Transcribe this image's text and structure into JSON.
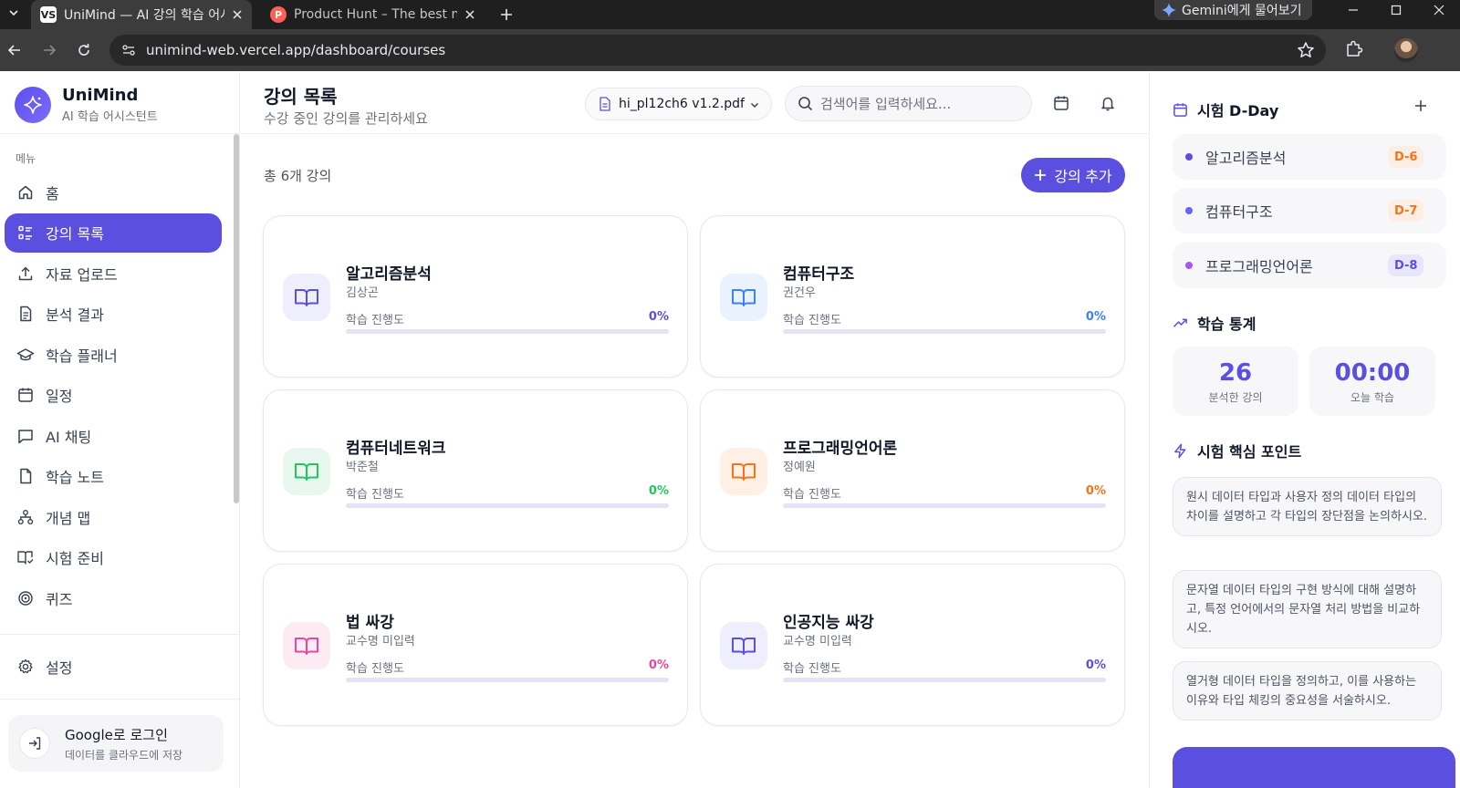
{
  "browser": {
    "tabs": [
      {
        "title": "UniMind — AI 강의 학습 어시스턴트",
        "favicon": "VS"
      },
      {
        "title": "Product Hunt – The best new products",
        "favicon": "P"
      }
    ],
    "gemini_label": "Gemini에게 물어보기",
    "url": "unimind-web.vercel.app/dashboard/courses"
  },
  "sidebar": {
    "brand_name": "UniMind",
    "brand_sub": "AI 학습 어시스턴트",
    "menu_label": "메뉴",
    "items": [
      {
        "label": "홈",
        "icon": "home-icon"
      },
      {
        "label": "강의 목록",
        "icon": "list-icon"
      },
      {
        "label": "자료 업로드",
        "icon": "upload-icon"
      },
      {
        "label": "분석 결과",
        "icon": "document-icon"
      },
      {
        "label": "학습 플래너",
        "icon": "graduation-cap-icon"
      },
      {
        "label": "일정",
        "icon": "calendar-icon"
      },
      {
        "label": "AI 채팅",
        "icon": "chat-icon"
      },
      {
        "label": "학습 노트",
        "icon": "note-icon"
      },
      {
        "label": "개념 맵",
        "icon": "network-icon"
      },
      {
        "label": "시험 준비",
        "icon": "book-check-icon"
      },
      {
        "label": "퀴즈",
        "icon": "target-icon"
      }
    ],
    "settings_label": "설정",
    "login_title": "Google로 로그인",
    "login_sub": "데이터를 클라우드에 저장"
  },
  "header": {
    "title": "강의 목록",
    "subtitle": "수강 중인 강의를 관리하세요",
    "file_name": "hi_pl12ch6 v1.2.pdf",
    "search_placeholder": "검색어를 입력하세요..."
  },
  "courses_summary": {
    "count_label": "총 6개 강의",
    "add_label": "강의 추가"
  },
  "courses": [
    {
      "title": "알고리즘분석",
      "professor": "김상곤",
      "progress_label": "학습 진행도",
      "progress": "0%",
      "progress_fraction": 0,
      "color": "#5b4fe0",
      "tint": "#efeefc"
    },
    {
      "title": "컴퓨터구조",
      "professor": "권건우",
      "progress_label": "학습 진행도",
      "progress": "0%",
      "progress_fraction": 0,
      "color": "#3b82f6",
      "tint": "#eaf2fe"
    },
    {
      "title": "컴퓨터네트워크",
      "professor": "박준철",
      "progress_label": "학습 진행도",
      "progress": "0%",
      "progress_fraction": 0,
      "color": "#22c55e",
      "tint": "#e8f8ee"
    },
    {
      "title": "프로그래밍언어론",
      "professor": "정예원",
      "progress_label": "학습 진행도",
      "progress": "0%",
      "progress_fraction": 0,
      "color": "#f97316",
      "tint": "#fff0e6"
    },
    {
      "title": "법 싸강",
      "professor": "교수명 미입력",
      "progress_label": "학습 진행도",
      "progress": "0%",
      "progress_fraction": 0,
      "color": "#ec4899",
      "tint": "#fdebf4"
    },
    {
      "title": "인공지능 싸강",
      "professor": "교수명 미입력",
      "progress_label": "학습 진행도",
      "progress": "0%",
      "progress_fraction": 0,
      "color": "#5b4fe0",
      "tint": "#efeefc"
    }
  ],
  "right_panel": {
    "dday_title": "시험 D-Day",
    "ddays": [
      {
        "name": "알고리즘분석",
        "badge": "D-6",
        "dot": "#5b4fe0",
        "badge_color": "#f97316",
        "badge_bg": "#fdeee3"
      },
      {
        "name": "컴퓨터구조",
        "badge": "D-7",
        "dot": "#6366f1",
        "badge_color": "#f97316",
        "badge_bg": "#fdeee3"
      },
      {
        "name": "프로그래밍언어론",
        "badge": "D-8",
        "dot": "#a855f7",
        "badge_color": "#5b4fe0",
        "badge_bg": "#e7e6fa"
      }
    ],
    "stats_title": "학습 통계",
    "stats": [
      {
        "value": "26",
        "label": "분석한 강의"
      },
      {
        "value": "00:00",
        "label": "오늘 학습"
      }
    ],
    "points_title": "시험 핵심 포인트",
    "points": [
      "원시 데이터 타입과 사용자 정의 데이터 타입의 차이를 설명하고 각 타입의 장단점을 논의하시오.",
      "문자열 데이터 타입의 구현 방식에 대해 설명하고, 특정 언어에서의 문자열 처리 방법을 비교하시오.",
      "열거형 데이터 타입을 정의하고, 이를 사용하는 이유와 타입 체킹의 중요성을 서술하시오."
    ]
  },
  "colors": {
    "accent": "#5b4fe0"
  }
}
